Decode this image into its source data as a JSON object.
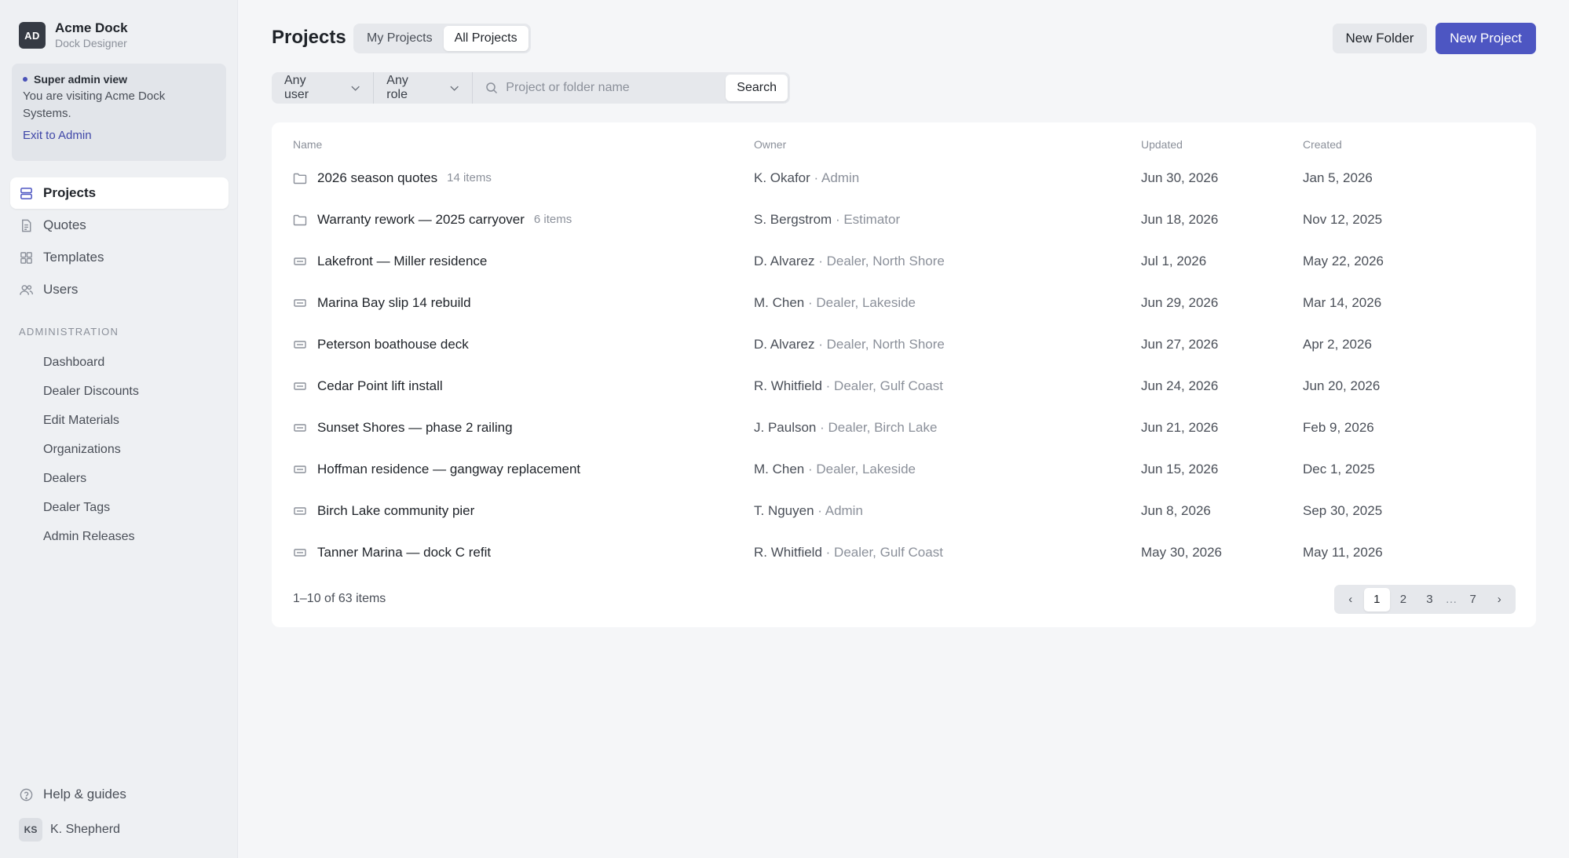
{
  "brand": {
    "initials": "AD",
    "name": "Acme Dock",
    "subtitle": "Dock Designer"
  },
  "admin_notice": {
    "title": "Super admin view",
    "description": "You are visiting Acme Dock Systems.",
    "link": "Exit to Admin"
  },
  "nav": [
    {
      "label": "Projects",
      "icon": "projects-icon",
      "active": true
    },
    {
      "label": "Quotes",
      "icon": "document-icon",
      "active": false
    },
    {
      "label": "Templates",
      "icon": "grid-icon",
      "active": false
    },
    {
      "label": "Users",
      "icon": "users-icon",
      "active": false
    }
  ],
  "admin_section": {
    "label": "ADMINISTRATION",
    "items": [
      "Dashboard",
      "Dealer Discounts",
      "Edit Materials",
      "Organizations",
      "Dealers",
      "Dealer Tags",
      "Admin Releases"
    ]
  },
  "footer_nav": {
    "help": "Help & guides",
    "user_initials": "KS",
    "user_name": "K. Shepherd"
  },
  "header": {
    "title": "Projects",
    "tabs": [
      {
        "label": "My Projects",
        "active": false
      },
      {
        "label": "All Projects",
        "active": true
      }
    ],
    "new_folder": "New Folder",
    "new_project": "New Project"
  },
  "filters": {
    "user": "Any user",
    "role": "Any role",
    "search_placeholder": "Project or folder name",
    "search_value": "",
    "search_button": "Search"
  },
  "table": {
    "columns": {
      "name": "Name",
      "owner": "Owner",
      "updated": "Updated",
      "created": "Created"
    },
    "rows": [
      {
        "type": "folder",
        "name": "2026 season quotes",
        "count": "14 items",
        "owner": "K. Okafor",
        "role": "· Admin",
        "updated": "Jun 30, 2026",
        "created": "Jan 5, 2026"
      },
      {
        "type": "folder",
        "name": "Warranty rework — 2025 carryover",
        "count": "6 items",
        "owner": "S. Bergstrom",
        "role": "· Estimator",
        "updated": "Jun 18, 2026",
        "created": "Nov 12, 2025"
      },
      {
        "type": "project",
        "name": "Lakefront — Miller residence",
        "count": "",
        "owner": "D. Alvarez",
        "role": "· Dealer, North Shore",
        "updated": "Jul 1, 2026",
        "created": "May 22, 2026"
      },
      {
        "type": "project",
        "name": "Marina Bay slip 14 rebuild",
        "count": "",
        "owner": "M. Chen",
        "role": "· Dealer, Lakeside",
        "updated": "Jun 29, 2026",
        "created": "Mar 14, 2026"
      },
      {
        "type": "project",
        "name": "Peterson boathouse deck",
        "count": "",
        "owner": "D. Alvarez",
        "role": "· Dealer, North Shore",
        "updated": "Jun 27, 2026",
        "created": "Apr 2, 2026"
      },
      {
        "type": "project",
        "name": "Cedar Point lift install",
        "count": "",
        "owner": "R. Whitfield",
        "role": "· Dealer, Gulf Coast",
        "updated": "Jun 24, 2026",
        "created": "Jun 20, 2026"
      },
      {
        "type": "project",
        "name": "Sunset Shores — phase 2 railing",
        "count": "",
        "owner": "J. Paulson",
        "role": "· Dealer, Birch Lake",
        "updated": "Jun 21, 2026",
        "created": "Feb 9, 2026"
      },
      {
        "type": "project",
        "name": "Hoffman residence — gangway replacement",
        "count": "",
        "owner": "M. Chen",
        "role": "· Dealer, Lakeside",
        "updated": "Jun 15, 2026",
        "created": "Dec 1, 2025"
      },
      {
        "type": "project",
        "name": "Birch Lake community pier",
        "count": "",
        "owner": "T. Nguyen",
        "role": "· Admin",
        "updated": "Jun 8, 2026",
        "created": "Sep 30, 2025"
      },
      {
        "type": "project",
        "name": "Tanner Marina — dock C refit",
        "count": "",
        "owner": "R. Whitfield",
        "role": "· Dealer, Gulf Coast",
        "updated": "May 30, 2026",
        "created": "May 11, 2026"
      }
    ]
  },
  "pagination": {
    "summary": "1–10 of 63 items",
    "prev": "‹",
    "pages": [
      "1",
      "2",
      "3",
      "…",
      "7"
    ],
    "current": "1",
    "next": "›"
  },
  "colors": {
    "accent": "#4d56c2",
    "link": "#3f47a8",
    "sidebar_bg": "#eef0f3",
    "page_bg": "#f5f6f8"
  }
}
